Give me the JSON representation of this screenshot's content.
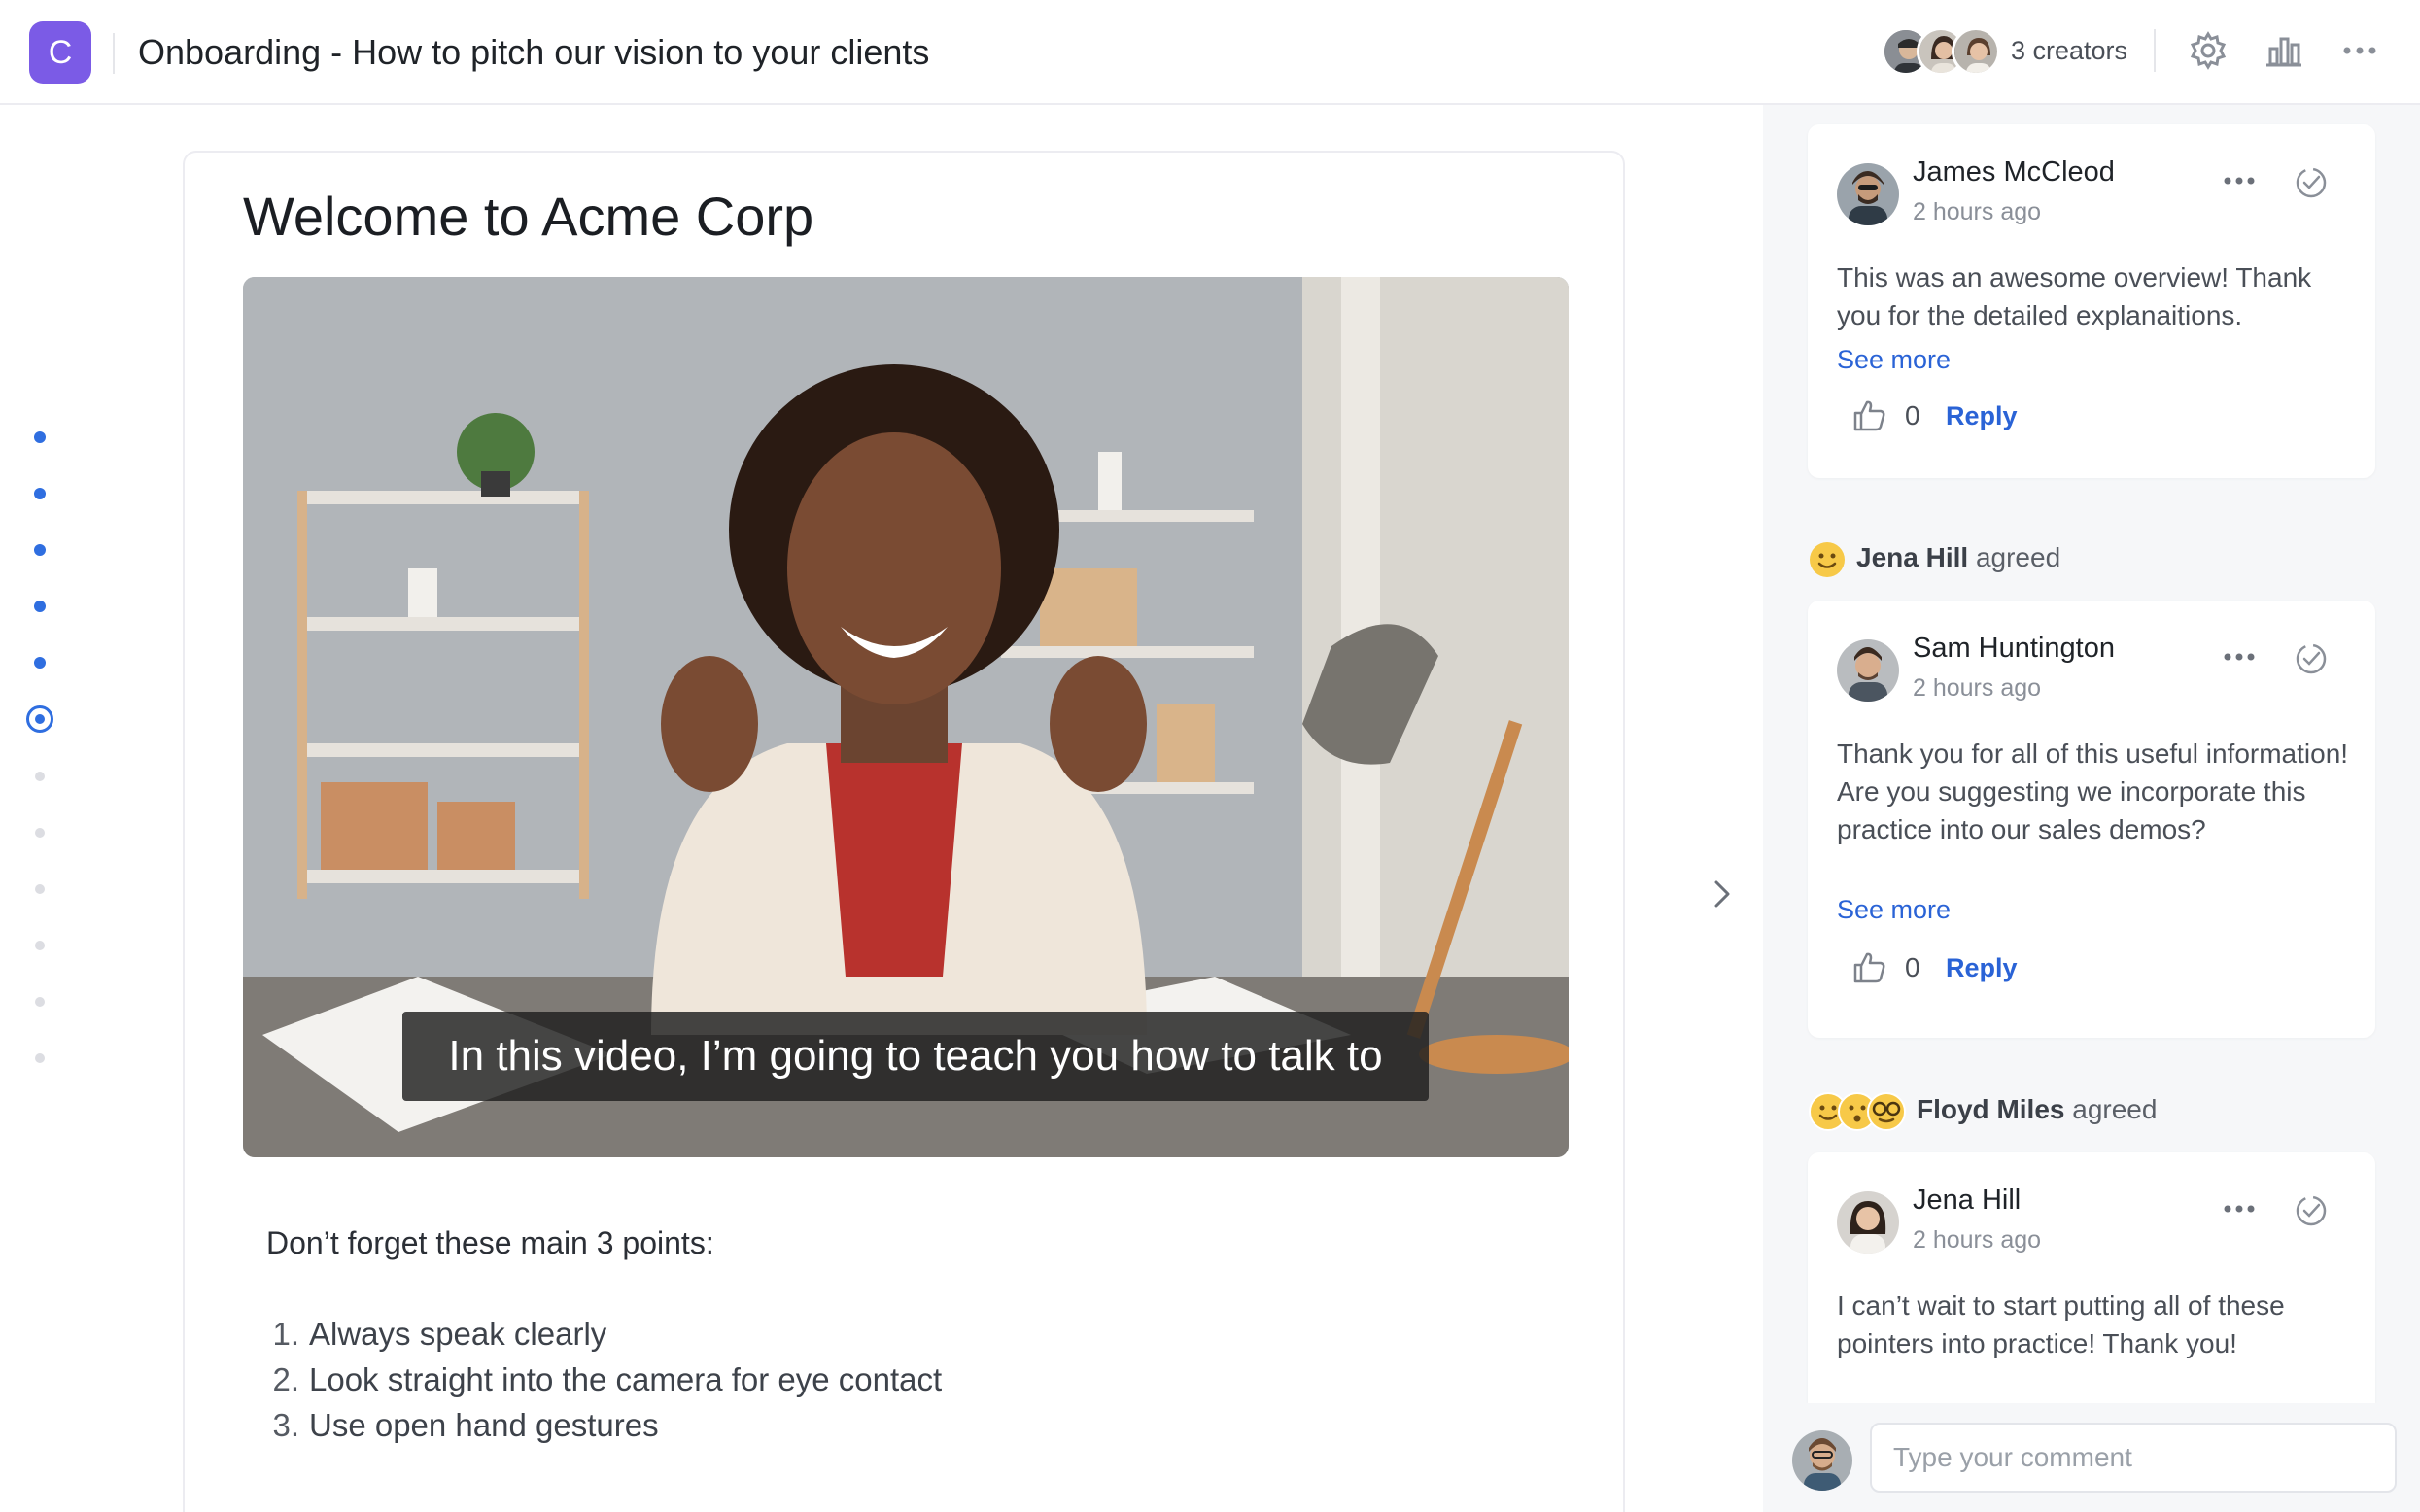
{
  "header": {
    "logo_letter": "C",
    "title": "Onboarding - How to pitch our vision to your clients",
    "creators_label": "3 creators"
  },
  "nav": {
    "dots": [
      "done",
      "done",
      "done",
      "done",
      "done",
      "current",
      "todo",
      "todo",
      "todo",
      "todo",
      "todo",
      "todo"
    ]
  },
  "main": {
    "heading": "Welcome to Acme Corp",
    "video_caption": "In this video, I’m going to teach you how to talk to",
    "points_title": "Don’t forget these main 3 points:",
    "points": [
      {
        "num": "1.",
        "text": "Always speak clearly"
      },
      {
        "num": "2.",
        "text": "Look straight into the camera for eye contact"
      },
      {
        "num": "3.",
        "text": "Use open hand gestures"
      }
    ]
  },
  "comments": [
    {
      "author": "James McCleod",
      "time": "2 hours ago",
      "text": "This was an awesome overview! Thank you for the detailed explanaitions.",
      "see_more": "See more",
      "likes": "0",
      "reply": "Reply"
    },
    {
      "author": "Sam Huntington",
      "time": "2 hours ago",
      "text": "Thank you for all of this useful information! Are you suggesting we incorporate this practice into our sales demos?",
      "see_more": "See more",
      "likes": "0",
      "reply": "Reply"
    },
    {
      "author": "Jena Hill",
      "time": "2 hours ago",
      "text": "I can’t wait to start putting all of these pointers into practice! Thank you!"
    }
  ],
  "agreements": [
    {
      "name": "Jena Hill",
      "verb": "agreed"
    },
    {
      "name": "Floyd Miles",
      "verb": "agreed"
    }
  ],
  "composer": {
    "placeholder": "Type your comment"
  },
  "colors": {
    "brand": "#7b5be6",
    "link": "#2a63d6",
    "nav_active": "#2f6ee0"
  }
}
